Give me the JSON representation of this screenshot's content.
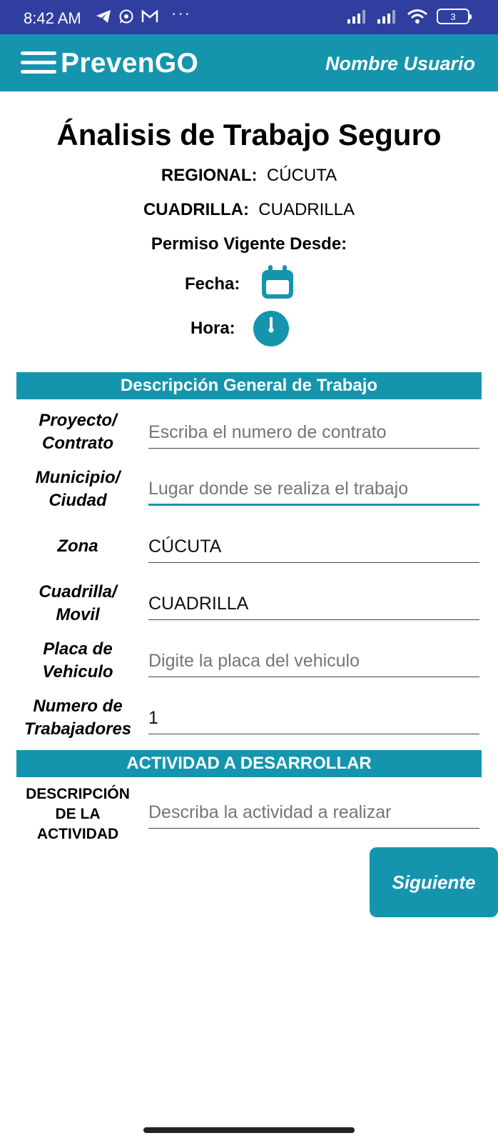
{
  "status_bar": {
    "time": "8:42 AM",
    "more": "···",
    "battery_level": "3",
    "icons": [
      "telegram-icon",
      "whatsapp-icon",
      "gmail-icon",
      "signal-icon",
      "signal-icon",
      "wifi-icon",
      "battery-icon"
    ]
  },
  "app_bar": {
    "title": "PrevenGO",
    "user_name": "Nombre Usuario"
  },
  "header": {
    "title": "Ánalisis de Trabajo Seguro",
    "regional_label": "REGIONAL:",
    "regional_value": "CÚCUTA",
    "cuadrilla_label": "CUADRILLA:",
    "cuadrilla_value": "CUADRILLA",
    "permiso_label": "Permiso Vigente Desde:",
    "fecha_label": "Fecha:",
    "hora_label": "Hora:"
  },
  "section_general": {
    "title": "Descripción General de Trabajo",
    "fields": [
      {
        "label_line1": "Proyecto/",
        "label_line2": "Contrato",
        "value": "",
        "placeholder": "Escriba el numero de contrato"
      },
      {
        "label_line1": "Municipio/",
        "label_line2": "Ciudad",
        "value": "",
        "placeholder": "Lugar donde se realiza el trabajo"
      },
      {
        "label_line1": "Zona",
        "label_line2": "",
        "value": "CÚCUTA",
        "placeholder": ""
      },
      {
        "label_line1": "Cuadrilla/",
        "label_line2": "Movil",
        "value": "CUADRILLA",
        "placeholder": ""
      },
      {
        "label_line1": "Placa de",
        "label_line2": "Vehiculo",
        "value": "",
        "placeholder": "Digite la placa del vehiculo"
      },
      {
        "label_line1": "Numero de",
        "label_line2": "Trabajadores",
        "value": "1",
        "placeholder": ""
      }
    ]
  },
  "section_activity": {
    "title": "ACTIVIDAD A DESARROLLAR",
    "label_line1": "DESCRIPCIÓN",
    "label_line2": "DE LA",
    "label_line3": "ACTIVIDAD",
    "value": "",
    "placeholder": "Describa la actividad a realizar"
  },
  "next_button": "Siguiente",
  "colors": {
    "status_bar": "#303f9f",
    "primary": "#1595ad"
  }
}
